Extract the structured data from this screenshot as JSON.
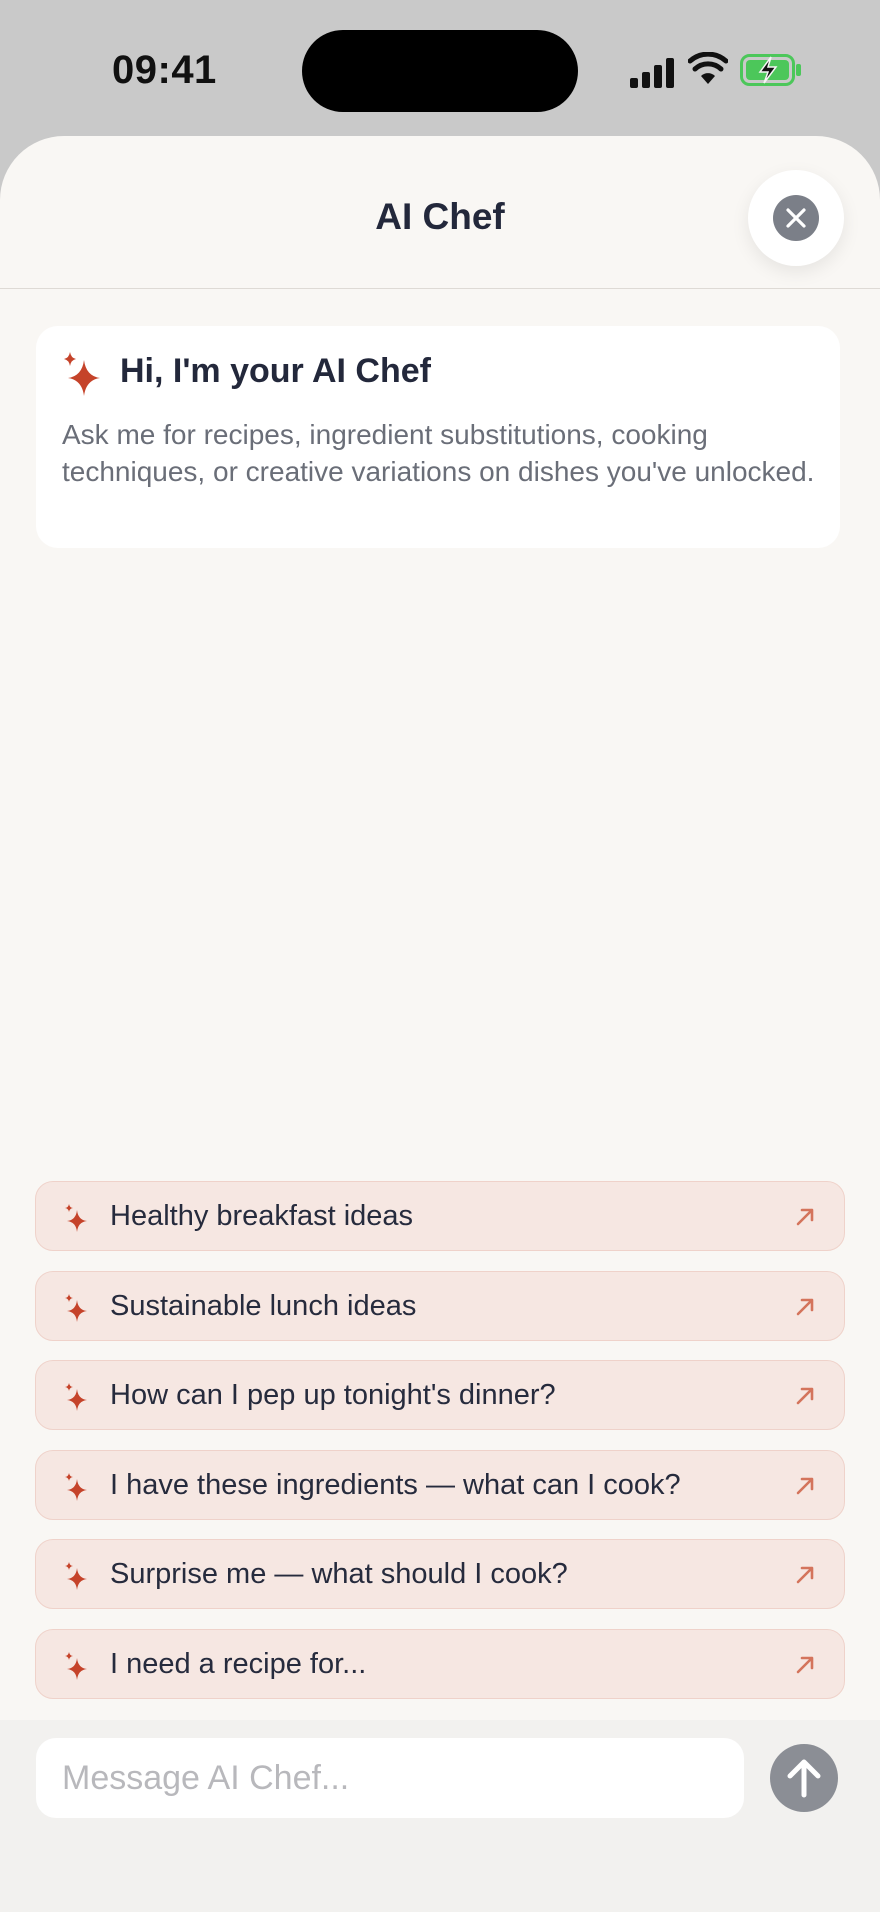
{
  "status_bar": {
    "time": "09:41"
  },
  "header": {
    "title": "AI Chef"
  },
  "welcome": {
    "title": "Hi, I'm your AI Chef",
    "body": "Ask me for recipes, ingredient substitutions, cooking techniques, or creative variations on dishes you've unlocked."
  },
  "suggestions": [
    "Healthy breakfast ideas",
    "Sustainable lunch ideas",
    "How can I pep up tonight's dinner?",
    "I have these ingredients — what can I cook?",
    "Surprise me — what should I cook?",
    "I need a recipe for..."
  ],
  "composer": {
    "placeholder": "Message AI Chef..."
  },
  "colors": {
    "accent": "#c5432a",
    "chip_background": "#f6e7e2",
    "sheet_background": "#f9f7f4",
    "battery_green": "#4cc75a"
  },
  "icons": [
    "signal-icon",
    "wifi-icon",
    "battery-charging-icon",
    "close-icon",
    "sparkle-icon",
    "arrow-up-right-icon",
    "arrow-up-icon"
  ]
}
